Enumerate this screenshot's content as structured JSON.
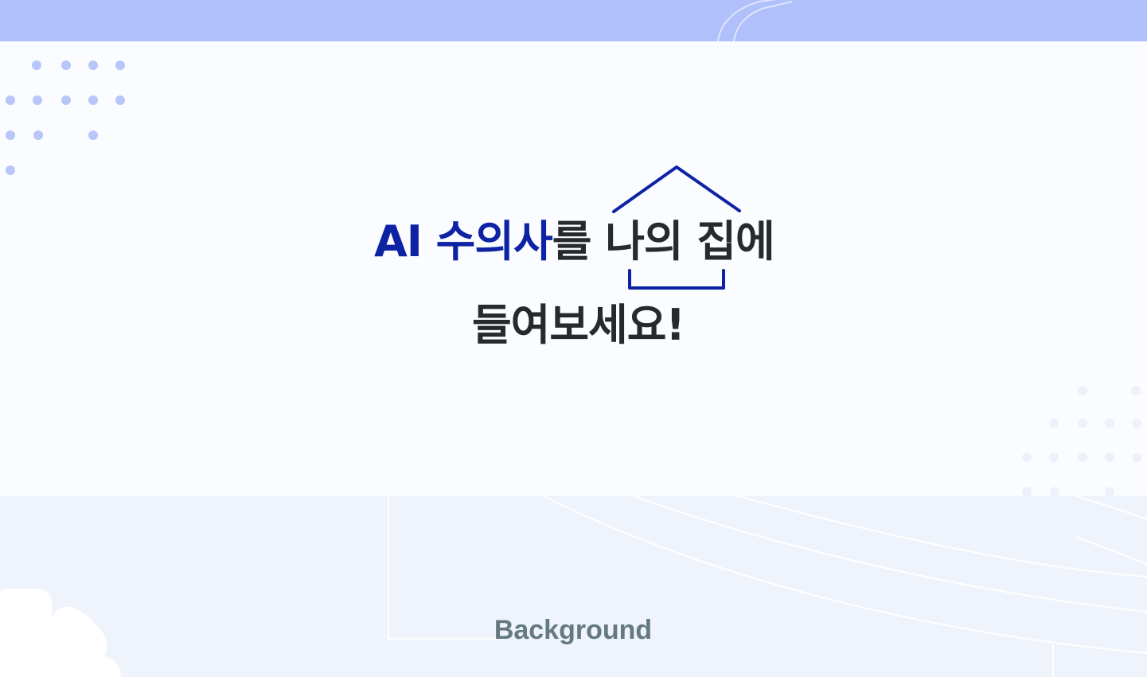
{
  "headline": {
    "line1_accent": "AI 수의사",
    "line1_rest_a": "를 ",
    "line1_rest_b": "나의 집에",
    "line2": "들여보세요!"
  },
  "section_label": "Background",
  "colors": {
    "top_band": "#b0c0fb",
    "card": "#fbfcff",
    "bottom": "#eff3fb",
    "accent": "#0d23a4",
    "text_dark": "#262a2e",
    "dots": "#b8c6fa",
    "label": "#647980"
  },
  "icons": [
    "house-outline-icon",
    "dot-pattern-decoration",
    "cloud-decoration"
  ]
}
